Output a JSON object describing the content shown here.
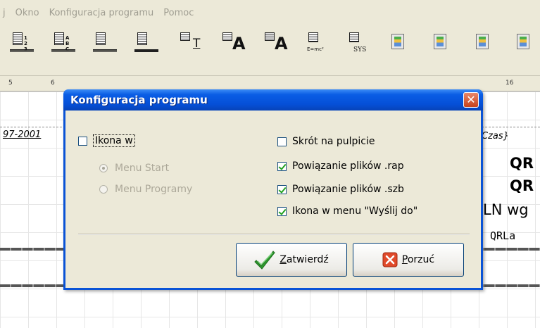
{
  "menu": {
    "items": [
      "j",
      "Okno",
      "Konfiguracja programu",
      "Pomoc"
    ]
  },
  "toolbar": {
    "icons": [
      {
        "name": "sections-1-2-3-icon",
        "glyph": "1 2 3"
      },
      {
        "name": "sections-a-b-c-icon",
        "glyph": "A B C"
      },
      {
        "name": "report-bottom-icon",
        "glyph": ""
      },
      {
        "name": "report-band-icon",
        "glyph": ""
      },
      {
        "name": "insert-text-icon",
        "glyph": "T"
      },
      {
        "name": "insert-label-icon",
        "glyph": "A"
      },
      {
        "name": "insert-db-label-icon",
        "glyph": "A"
      },
      {
        "name": "insert-formula-icon",
        "glyph": "E=mc²"
      },
      {
        "name": "insert-system-field-icon",
        "glyph": "SYS"
      },
      {
        "name": "color-doc-icon",
        "glyph": ""
      },
      {
        "name": "color-doc-plus-icon",
        "glyph": ""
      },
      {
        "name": "color-doc-lines-icon",
        "glyph": ""
      },
      {
        "name": "color-doc-extra-icon",
        "glyph": ""
      }
    ]
  },
  "ruler": {
    "marks": [
      "5",
      "6",
      "16"
    ]
  },
  "report": {
    "left_text": "97-2001",
    "right_top": "Czas}",
    "right_labels": [
      "QR",
      "QR",
      "LN wg",
      "QRLa"
    ]
  },
  "dialog": {
    "title": "Konfiguracja programu",
    "close_label": "✕",
    "left": {
      "ikona_label": "Ikona w",
      "ikona_checked": false,
      "radio_start": "Menu Start",
      "radio_programy": "Menu Programy",
      "radio_selected": "Menu Start"
    },
    "right": {
      "checkboxes": [
        {
          "label": "Skrót na pulpicie",
          "checked": false
        },
        {
          "label": "Powiązanie plików .rap",
          "checked": true
        },
        {
          "label": "Powiązanie plików .szb",
          "checked": true
        },
        {
          "label": "Ikona w menu \"Wyślij do\"",
          "checked": true
        }
      ]
    },
    "buttons": {
      "confirm_first": "Z",
      "confirm_rest": "atwierdź",
      "cancel_first": "P",
      "cancel_rest": "orzuć"
    }
  },
  "colors": {
    "titlebar": "#0a5de5",
    "dialog_bg": "#ece9d8",
    "check": "#21a121",
    "close": "#c8421b"
  }
}
